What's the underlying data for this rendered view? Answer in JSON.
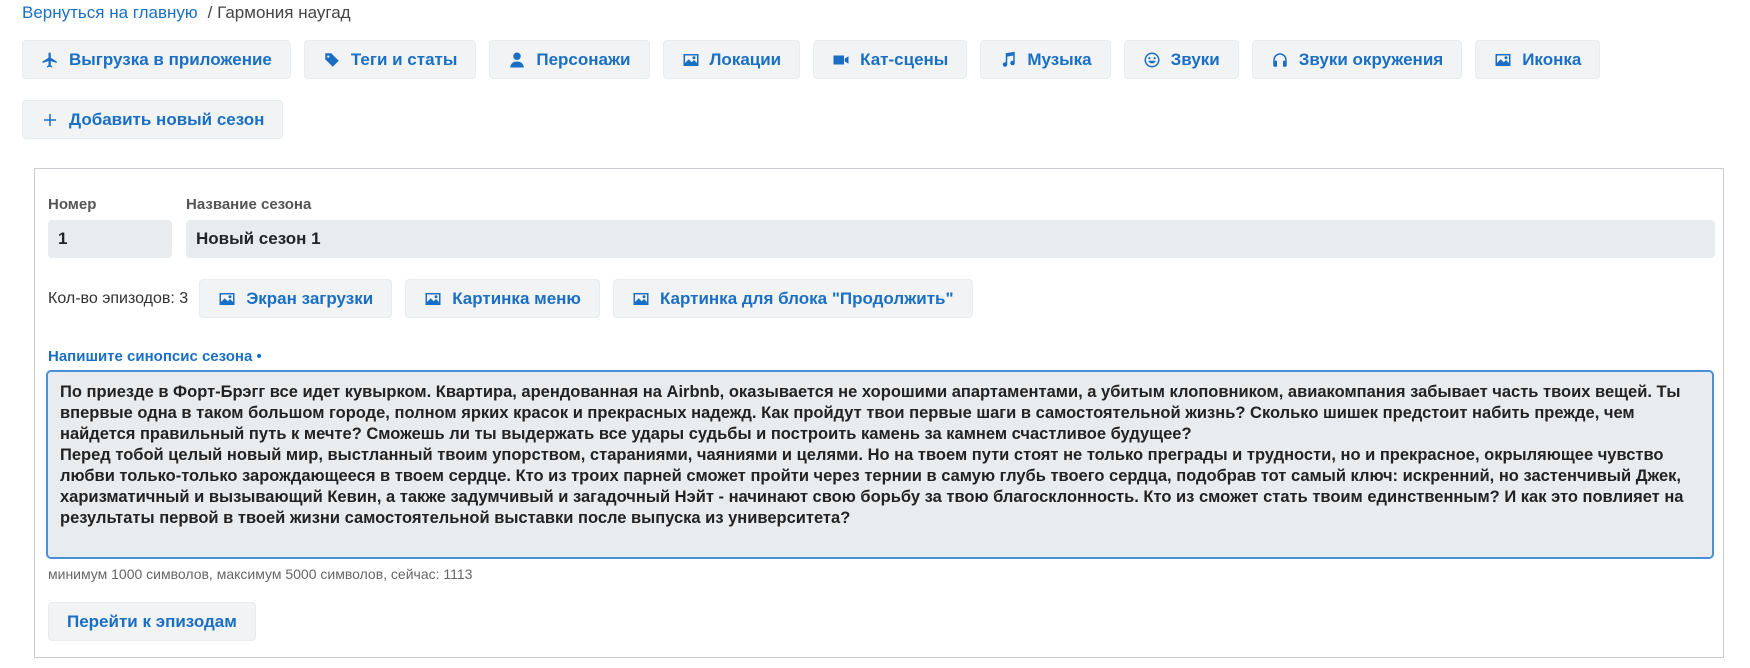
{
  "breadcrumb": {
    "home_link": "Вернуться на главную",
    "current": "/ Гармония наугад"
  },
  "toolbar": {
    "items": [
      {
        "label": "Выгрузка в приложение",
        "icon": "plane-icon"
      },
      {
        "label": "Теги и статы",
        "icon": "tags-icon"
      },
      {
        "label": "Персонажи",
        "icon": "user-icon"
      },
      {
        "label": "Локации",
        "icon": "image-icon"
      },
      {
        "label": "Кат-сцены",
        "icon": "video-icon"
      },
      {
        "label": "Музыка",
        "icon": "music-icon"
      },
      {
        "label": "Звуки",
        "icon": "smile-icon"
      },
      {
        "label": "Звуки окружения",
        "icon": "headphones-icon"
      },
      {
        "label": "Иконка",
        "icon": "image-icon"
      }
    ],
    "add_season": "Добавить новый сезон"
  },
  "season": {
    "number_label": "Номер",
    "number_value": "1",
    "name_label": "Название сезона",
    "name_value": "Новый сезон 1",
    "episodes_count": "Кол-во эпизодов: 3",
    "loading_screen_button": "Экран загрузки",
    "menu_picture_button": "Картинка меню",
    "continue_picture_button": "Картинка для блока \"Продолжить\"",
    "synopsis_label": "Напишите синопсис сезона •",
    "synopsis_text": "По приезде в Форт-Брэгг все идет кувырком. Квартира, арендованная на Airbnb, оказывается не хорошими апартаментами, а убитым клоповником, авиакомпания забывает часть твоих вещей. Ты впервые одна в таком большом городе, полном ярких красок и прекрасных надежд. Как пройдут твои первые шаги в самостоятельной жизнь? Сколько шишек предстоит набить прежде, чем найдется правильный путь к мечте? Сможешь ли ты выдержать все удары судьбы и построить камень за камнем счастливое будущее?\nПеред тобой целый новый мир, выстланный твоим упорством, стараниями, чаяниями и целями. Но на твоем пути стоят не только преграды и трудности, но и прекрасное, окрыляющее чувство любви только-только зарождающееся в твоем сердце. Кто из троих парней сможет пройти через тернии в самую глубь твоего сердца, подобрав тот самый ключ: искренний, но застенчивый Джек, харизматичный и вызывающий Кевин, а также задумчивый и загадочный Нэйт - начинают свою борьбу за твою благосклонность. Кто из сможет стать твоим единственным? И как это повлияет на результаты первой в твоей жизни самостоятельной выставки после выпуска из университета?",
    "synopsis_hint": "минимум 1000 символов, максимум 5000 символов, сейчас: 1113",
    "goto_episodes_button": "Перейти к эпизодам"
  },
  "colors": {
    "accent": "#1a6fc4",
    "button_bg": "#f1f3f5",
    "field_bg": "#e9ecef",
    "focus_border": "#4a90d9"
  }
}
